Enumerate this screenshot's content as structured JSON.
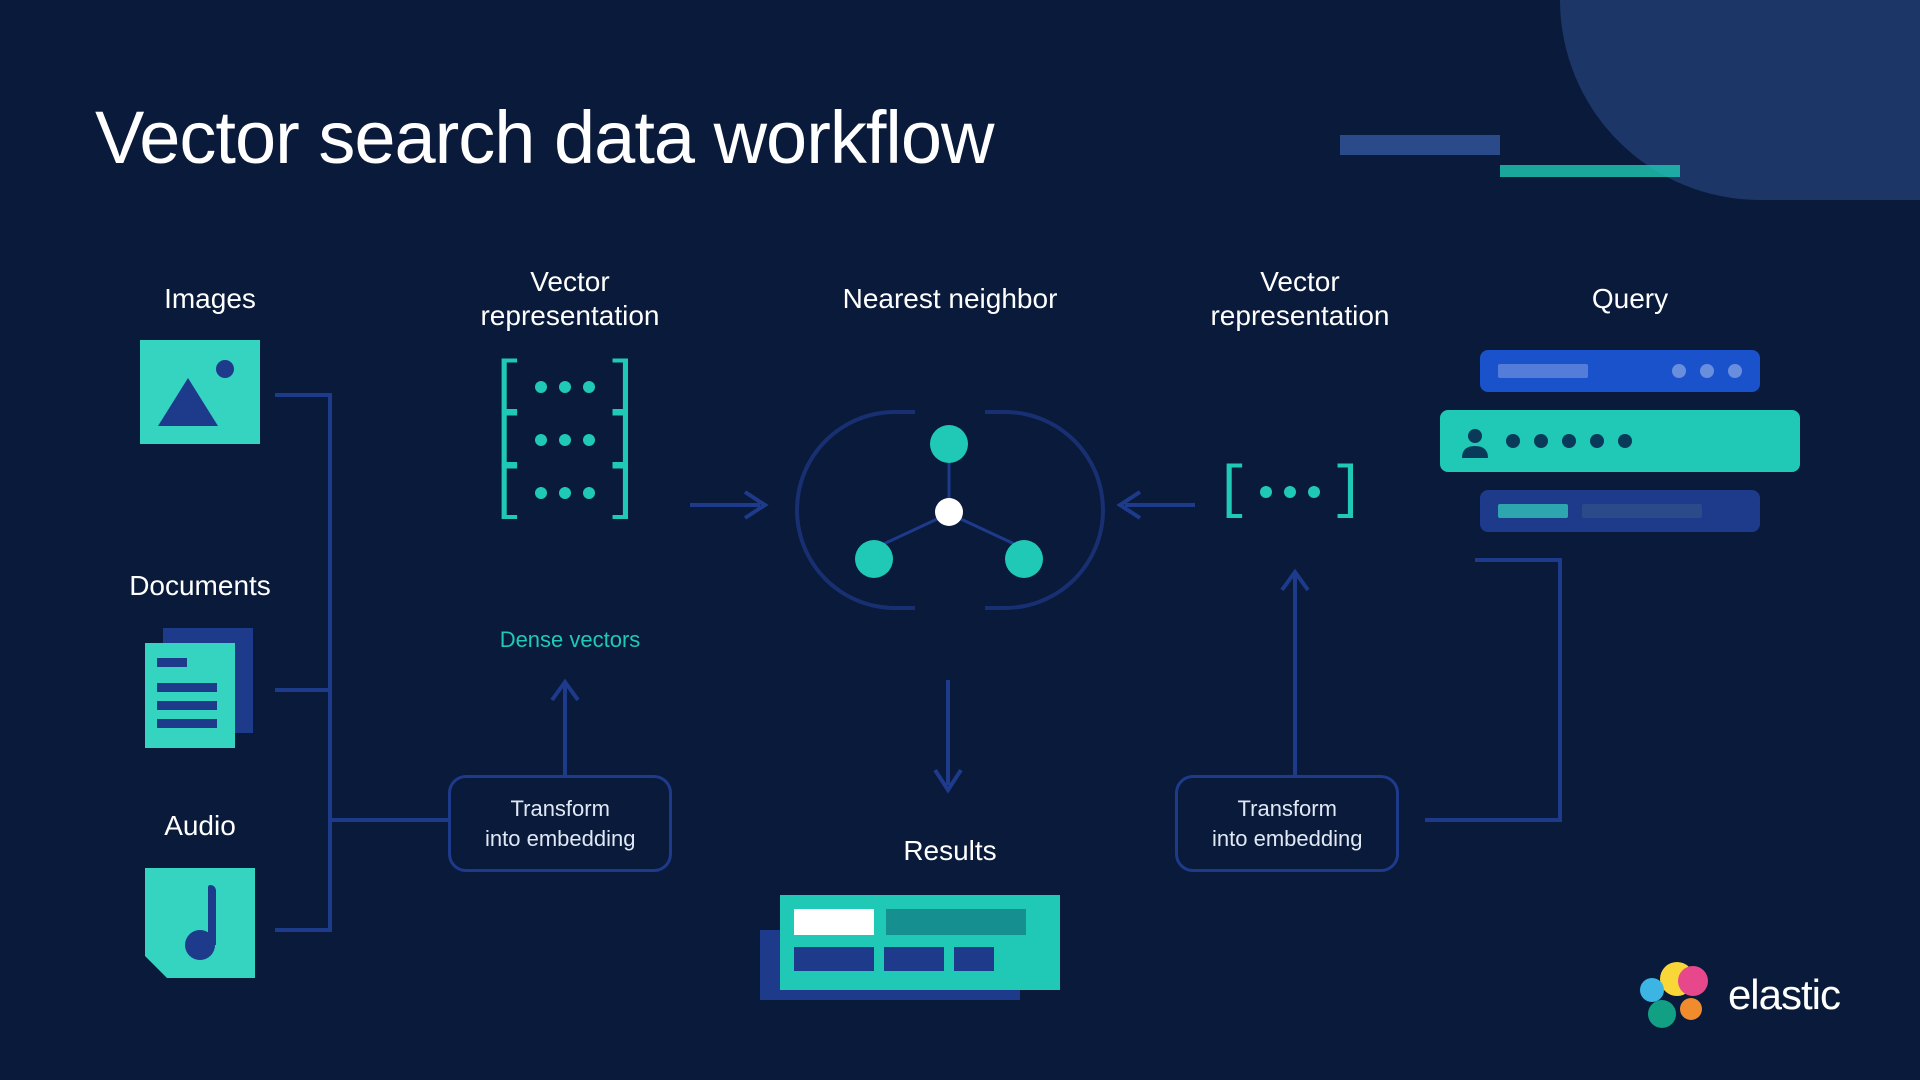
{
  "title": "Vector search data workflow",
  "labels": {
    "images": "Images",
    "documents": "Documents",
    "audio": "Audio",
    "vector_rep": "Vector\nrepresentation",
    "dense": "Dense vectors",
    "nearest": "Nearest neighbor",
    "results": "Results",
    "query": "Query"
  },
  "transform": {
    "line1": "Transform",
    "line2": "into embedding"
  },
  "logo": "elastic"
}
